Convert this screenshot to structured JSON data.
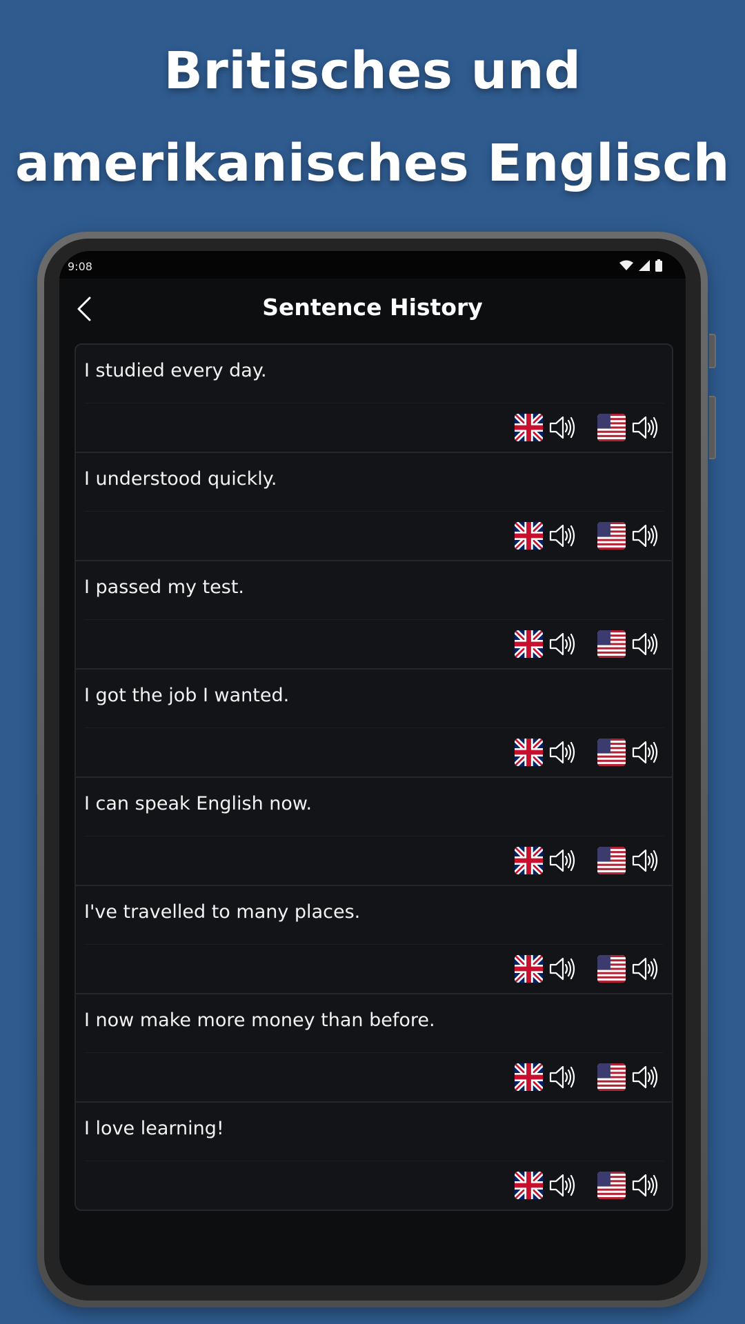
{
  "headline": {
    "line1": "Britisches und",
    "line2": "amerikanisches Englisch"
  },
  "status_bar": {
    "time": "9:08",
    "icons": [
      "wifi-icon",
      "signal-icon",
      "battery-icon"
    ]
  },
  "app_bar": {
    "back_icon": "back-arrow-icon",
    "title": "Sentence History"
  },
  "sentences": [
    "I studied every day.",
    "I understood quickly.",
    "I passed my test.",
    "I got the job I wanted.",
    "I can speak English now.",
    "I've travelled to many places.",
    "I now make more money than before.",
    "I love learning!"
  ],
  "audio_buttons": [
    {
      "flag": "uk-flag-icon",
      "icon": "speaker-icon"
    },
    {
      "flag": "us-flag-icon",
      "icon": "speaker-icon"
    }
  ],
  "colors": {
    "background": "#2f5b8f",
    "screen": "#0d0e10",
    "card": "#131417",
    "text": "#ffffff"
  }
}
